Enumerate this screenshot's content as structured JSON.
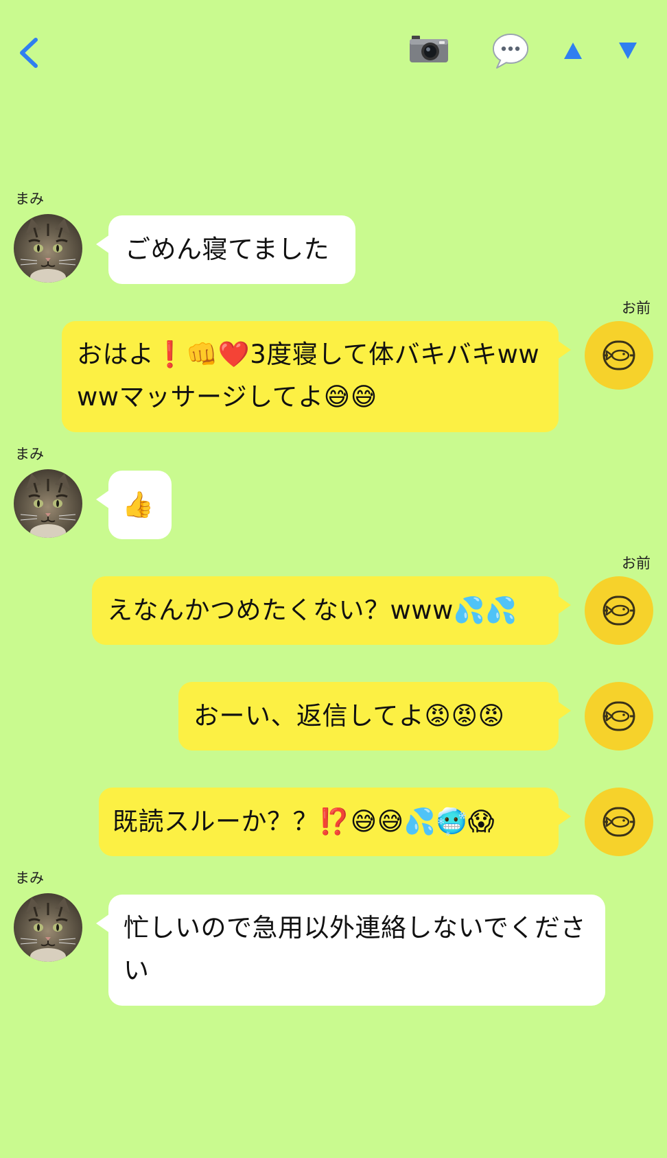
{
  "header": {
    "back_icon": "chevron-left-icon",
    "camera_icon": "camera-icon",
    "chat_icon": "speech-bubble-icon",
    "up_icon": "triangle-up-icon",
    "down_icon": "triangle-down-icon",
    "accent_color": "#2f7ff0"
  },
  "colors": {
    "background": "#c9fa8f",
    "bubble_received": "#ffffff",
    "bubble_sent": "#fcf044",
    "my_avatar": "#f6d22b"
  },
  "messages": [
    {
      "sender": "まみ",
      "direction": "received",
      "text": "ごめん寝てました"
    },
    {
      "sender": "お前",
      "direction": "sent",
      "text": "おはよ❗️👊❤️3度寝して体バキバキwwwwマッサージしてよ😅😅"
    },
    {
      "sender": "まみ",
      "direction": "received",
      "text": "👍"
    },
    {
      "sender": "お前",
      "direction": "sent",
      "text": "えなんかつめたくない？www💦💦"
    },
    {
      "sender": "",
      "direction": "sent",
      "text": "おーい、返信してよ😡😡😡"
    },
    {
      "sender": "",
      "direction": "sent",
      "text": "既読スルーか？？⁉️😅😅💦🥶😱"
    },
    {
      "sender": "まみ",
      "direction": "received",
      "text": "忙しいので急用以外連絡しないでください"
    }
  ]
}
